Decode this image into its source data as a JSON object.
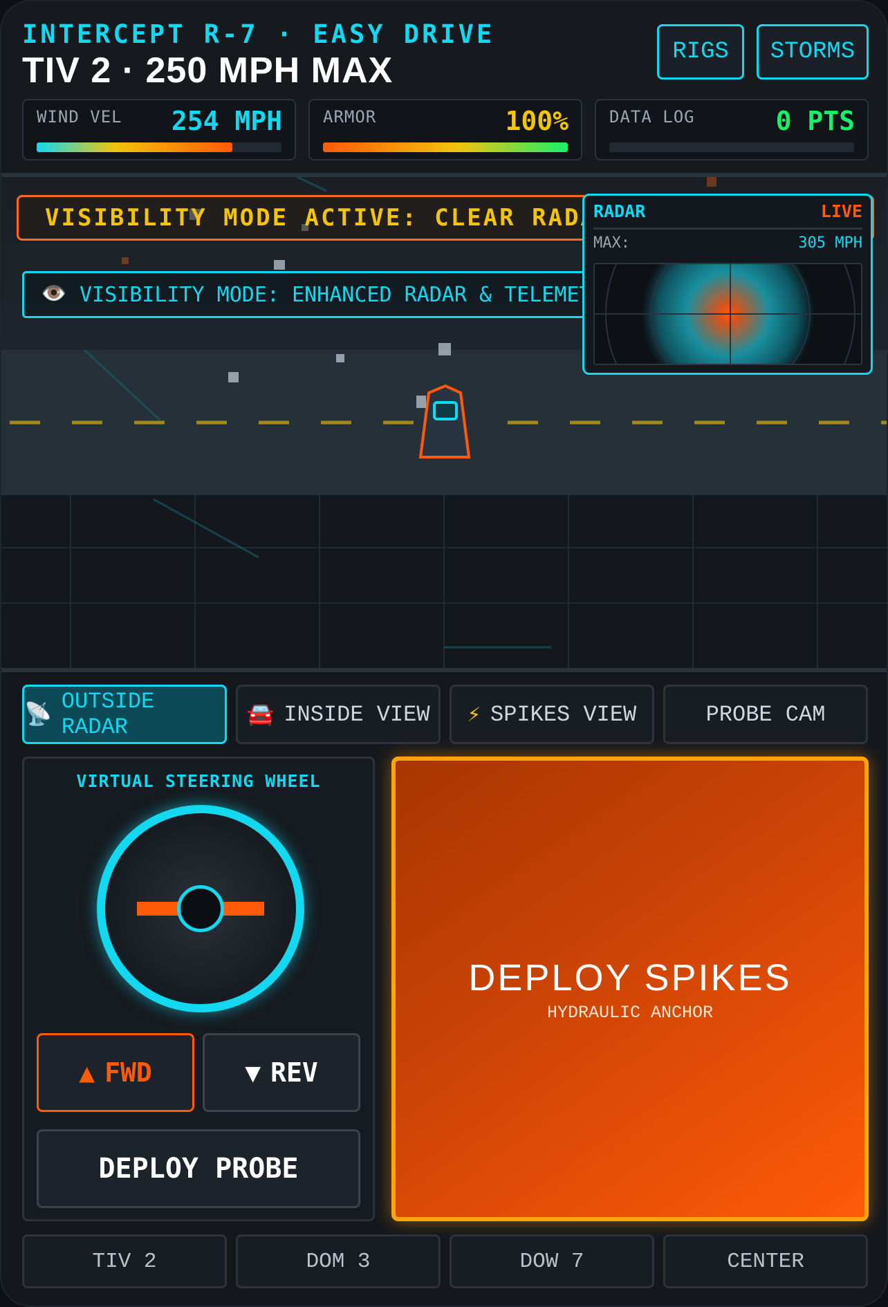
{
  "header": {
    "subtitle": "INTERCEPT R-7 · EASY DRIVE",
    "title": "TIV 2 · 250 MPH MAX",
    "buttons": {
      "rigs": "RIGS",
      "storms": "STORMS"
    }
  },
  "stats": {
    "wind": {
      "label": "WIND VEL",
      "value": "254 MPH",
      "fill_fraction": 0.8
    },
    "armor": {
      "label": "ARMOR",
      "value": "100%",
      "fill_fraction": 1.0
    },
    "log": {
      "label": "DATA LOG",
      "value": "0 PTS",
      "fill_fraction": 0
    }
  },
  "scene": {
    "warning_banner": "VISIBILITY MODE ACTIVE: CLEAR RADAR &amp; TELEMETRY",
    "visibility_banner": {
      "icon": "eye-icon",
      "glyph": "👁️",
      "text": "VISIBILITY MODE: ENHANCED RADAR & TELEMETRY"
    },
    "radar": {
      "title": "RADAR",
      "status": "LIVE",
      "max_label": "MAX:",
      "max_value": "305 MPH"
    }
  },
  "view_buttons": [
    {
      "icon": "satellite-dish-icon",
      "glyph": "📡",
      "label": "OUTSIDE RADAR",
      "active": true
    },
    {
      "icon": "car-icon",
      "glyph": "🚘",
      "label": "INSIDE VIEW",
      "active": false
    },
    {
      "icon": "lightning-icon",
      "glyph": "⚡",
      "label": "SPIKES VIEW",
      "active": false
    },
    {
      "icon": "",
      "glyph": "",
      "label": "PROBE CAM",
      "active": false
    }
  ],
  "controls": {
    "wheel_title": "VIRTUAL STEERING WHEEL",
    "fwd": {
      "glyph": "▲",
      "label": "FWD"
    },
    "rev": {
      "glyph": "▼",
      "label": "REV"
    },
    "probe": "DEPLOY PROBE",
    "spikes": {
      "title": "DEPLOY SPIKES",
      "subtitle": "HYDRAULIC ANCHOR"
    }
  },
  "locations": [
    "TIV 2",
    "DOM 3",
    "DOW 7",
    "CENTER"
  ],
  "colors": {
    "accent_cyan": "#12d8f0",
    "accent_orange": "#ff5a08",
    "accent_yellow": "#f2c40c",
    "accent_green": "#19f06a"
  }
}
